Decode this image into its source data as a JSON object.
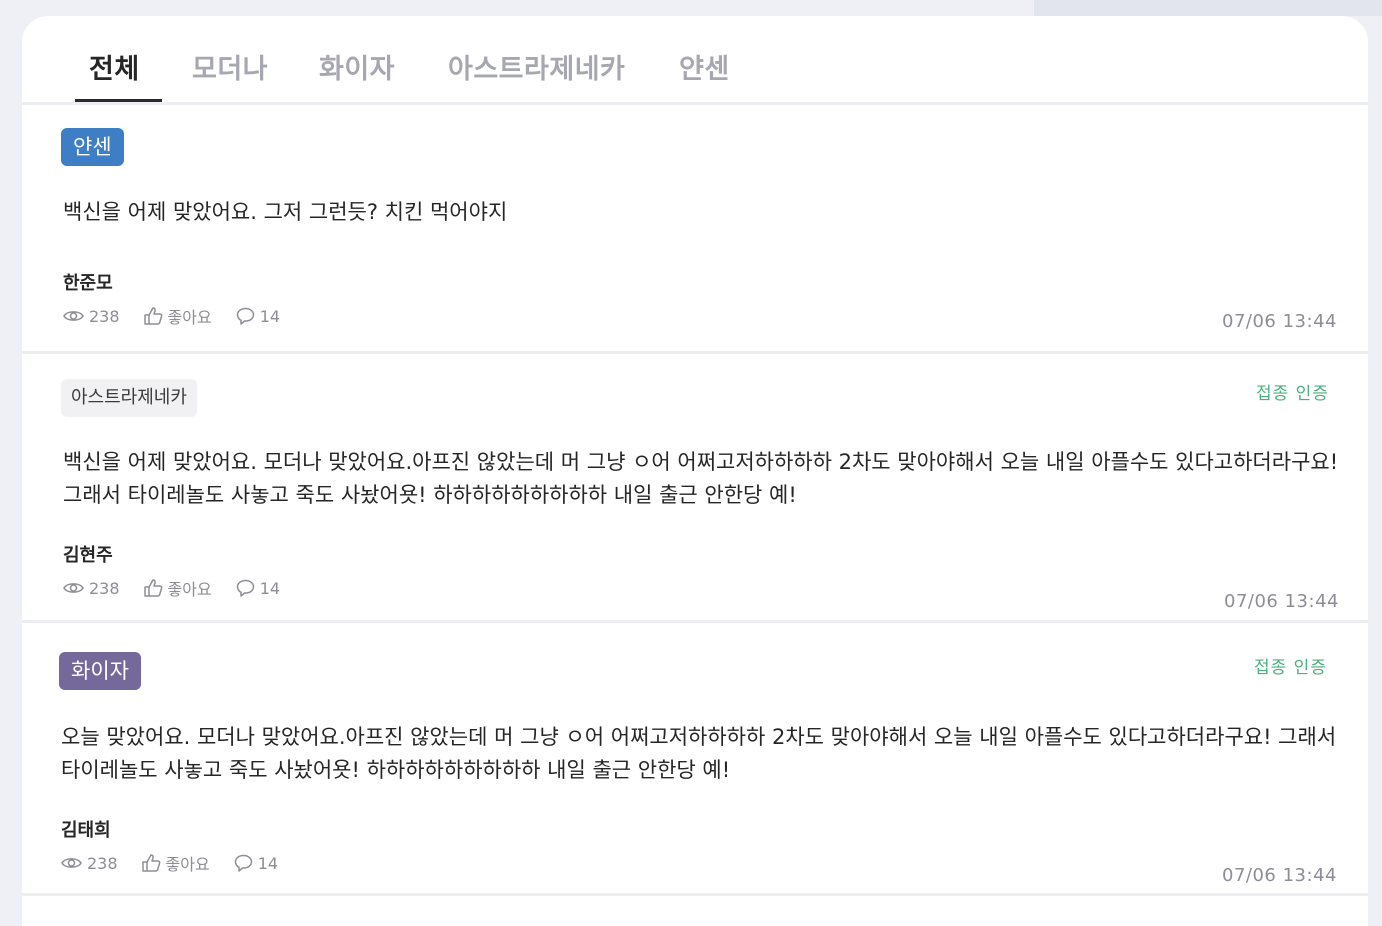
{
  "tabs": [
    {
      "label": "전체",
      "active": true
    },
    {
      "label": "모더나",
      "active": false
    },
    {
      "label": "화이자",
      "active": false
    },
    {
      "label": "아스트라제네카",
      "active": false
    },
    {
      "label": "얀센",
      "active": false
    }
  ],
  "posts": [
    {
      "tag": "얀센",
      "certified": "",
      "text": "백신을 어제 맞았어요. 그저 그런듯? 치킨 먹어야지",
      "author": "한준모",
      "views": "238",
      "like_label": "좋아요",
      "comments": "14",
      "time": "07/06 13:44"
    },
    {
      "tag": "아스트라제네카",
      "certified": "접종 인증",
      "text": "백신을 어제 맞았어요. 모더나 맞았어요.아프진 않았는데 머 그냥 ㅇ어 어쩌고저하하하하 2차도 맞아야해서 오늘 내일 아플수도 있다고하더라구요! 그래서 타이레놀도 사놓고 죽도 사놨어욧! 하하하하하하하하하 내일 출근 안한당 예!",
      "author": "김현주",
      "views": "238",
      "like_label": "좋아요",
      "comments": "14",
      "time": "07/06 13:44"
    },
    {
      "tag": "화이자",
      "certified": "접종 인증",
      "text": "오늘 맞았어요. 모더나 맞았어요.아프진 않았는데 머 그냥 ㅇ어 어쩌고저하하하하 2차도 맞아야해서 오늘 내일 아플수도 있다고하더라구요! 그래서 타이레놀도 사놓고 죽도 사놨어욧! 하하하하하하하하하 내일 출근 안한당 예!",
      "author": "김태희",
      "views": "238",
      "like_label": "좋아요",
      "comments": "14",
      "time": "07/06 13:44"
    }
  ],
  "colors": {
    "janssen_badge": "#3d7ec4",
    "pfizer_badge": "#75699c",
    "astra_badge": "#f1f1f3",
    "certified_text": "#4caf7d"
  },
  "icons": {
    "views": "eye-icon",
    "like": "thumbs-up-icon",
    "comments": "comment-icon"
  }
}
